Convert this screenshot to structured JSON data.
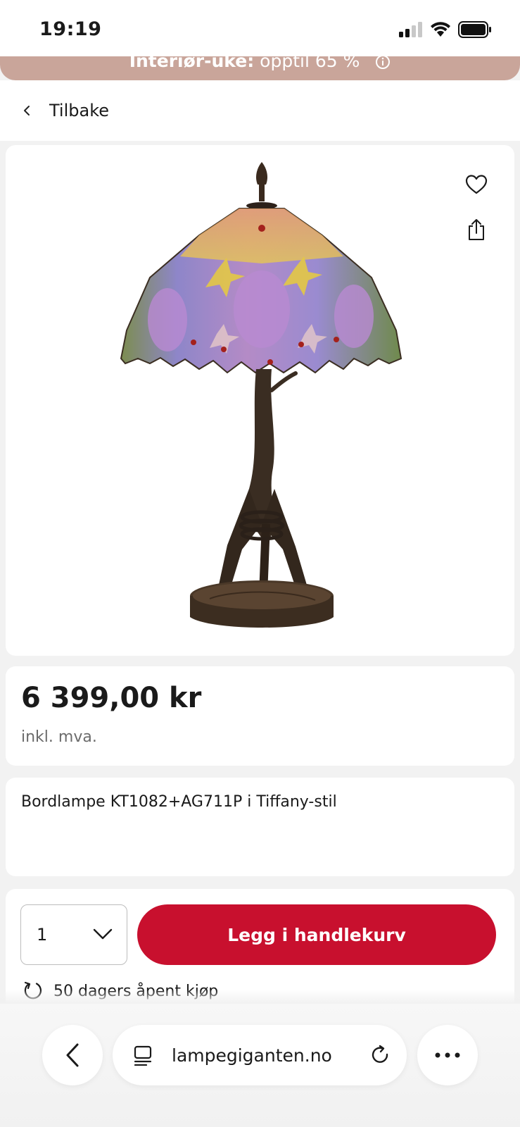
{
  "status_bar": {
    "time": "19:19"
  },
  "promo": {
    "bold": "Interiør-uke:",
    "rest": "opptil 65 %"
  },
  "nav": {
    "back_label": "Tilbake"
  },
  "product": {
    "price": "6 399,00 kr",
    "vat_note": "inkl. mva.",
    "title": "Bordlampe KT1082+AG711P i Tiffany-stil"
  },
  "cart": {
    "quantity": "1",
    "add_label": "Legg i handlekurv",
    "return_policy": "50 dagers åpent kjøp"
  },
  "browser": {
    "url": "lampegiganten.no"
  },
  "colors": {
    "accent": "#c8102e",
    "promo_bg": "#c9a59a"
  },
  "icons": [
    "signal-icon",
    "wifi-icon",
    "battery-icon",
    "info-icon",
    "chevron-left-icon",
    "heart-icon",
    "share-icon",
    "chevron-down-icon",
    "return-icon",
    "tabs-icon",
    "reload-icon",
    "more-icon"
  ]
}
